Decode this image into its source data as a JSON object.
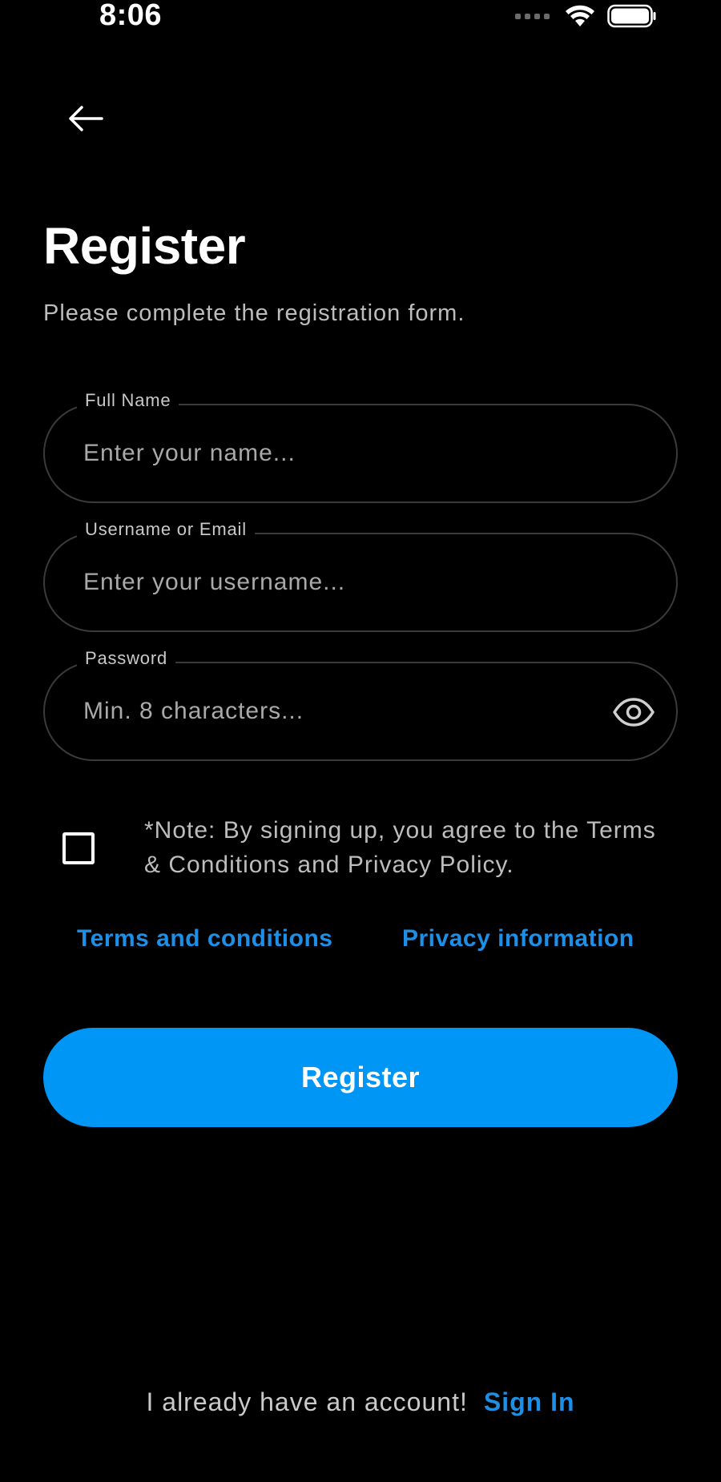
{
  "status_bar": {
    "time": "8:06",
    "icons": [
      "signal-dots-icon",
      "wifi-icon",
      "battery-icon"
    ]
  },
  "nav": {
    "back_icon": "arrow-left-icon"
  },
  "header": {
    "title": "Register",
    "subtitle": "Please complete the registration form."
  },
  "form": {
    "full_name": {
      "label": "Full Name",
      "placeholder": "Enter your name...",
      "value": ""
    },
    "username": {
      "label": "Username or Email",
      "placeholder": "Enter your username...",
      "value": ""
    },
    "password": {
      "label": "Password",
      "placeholder": "Min. 8 characters...",
      "value": "",
      "toggle_icon": "eye-icon"
    }
  },
  "terms": {
    "checked": false,
    "note": "*Note: By signing up, you agree to the Terms & Conditions and Privacy Policy.",
    "terms_link": "Terms and conditions",
    "privacy_link": "Privacy information"
  },
  "actions": {
    "register_label": "Register"
  },
  "footer": {
    "text": "I already have an account!",
    "sign_in_label": "Sign In"
  },
  "colors": {
    "background": "#000000",
    "accent": "#0096f5",
    "link": "#1e8fe6",
    "text_secondary": "#bdbdbd"
  }
}
